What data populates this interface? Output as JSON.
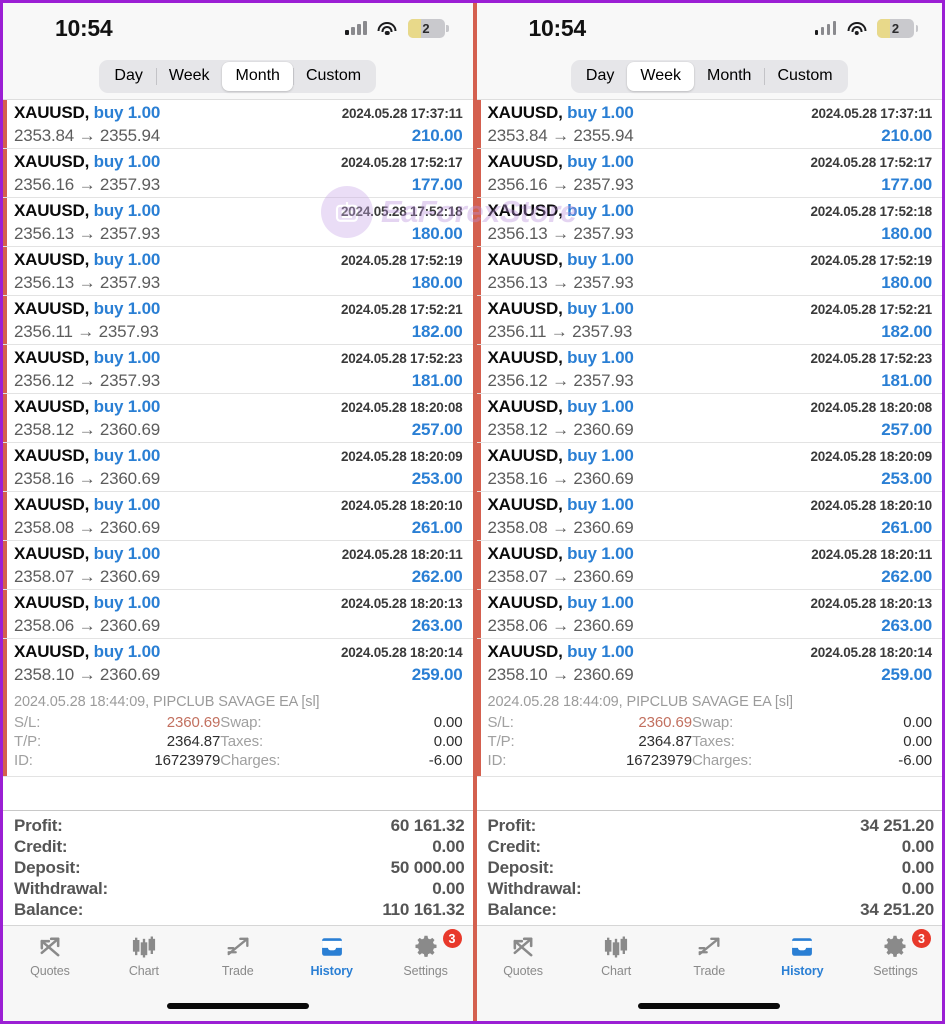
{
  "status_bar": {
    "time": "10:54",
    "battery_level": "2",
    "signal_icon": "cellular-signal-icon",
    "wifi_icon": "wifi-icon",
    "battery_icon": "battery-icon"
  },
  "period_filter": {
    "options": [
      "Day",
      "Week",
      "Month",
      "Custom"
    ],
    "left_selected": "Month",
    "right_selected": "Week"
  },
  "colors": {
    "profit_blue": "#2a7fd4",
    "accent_red": "#d4604f",
    "badge_red": "#e8392b",
    "frame_purple": "#9b1fd4"
  },
  "deals": [
    {
      "symbol": "XAUUSD,",
      "side": "buy",
      "volume": "1.00",
      "time": "2024.05.28 17:37:11",
      "open": "2353.84",
      "close": "2355.94",
      "profit": "210.00"
    },
    {
      "symbol": "XAUUSD,",
      "side": "buy",
      "volume": "1.00",
      "time": "2024.05.28 17:52:17",
      "open": "2356.16",
      "close": "2357.93",
      "profit": "177.00"
    },
    {
      "symbol": "XAUUSD,",
      "side": "buy",
      "volume": "1.00",
      "time": "2024.05.28 17:52:18",
      "open": "2356.13",
      "close": "2357.93",
      "profit": "180.00"
    },
    {
      "symbol": "XAUUSD,",
      "side": "buy",
      "volume": "1.00",
      "time": "2024.05.28 17:52:19",
      "open": "2356.13",
      "close": "2357.93",
      "profit": "180.00"
    },
    {
      "symbol": "XAUUSD,",
      "side": "buy",
      "volume": "1.00",
      "time": "2024.05.28 17:52:21",
      "open": "2356.11",
      "close": "2357.93",
      "profit": "182.00"
    },
    {
      "symbol": "XAUUSD,",
      "side": "buy",
      "volume": "1.00",
      "time": "2024.05.28 17:52:23",
      "open": "2356.12",
      "close": "2357.93",
      "profit": "181.00"
    },
    {
      "symbol": "XAUUSD,",
      "side": "buy",
      "volume": "1.00",
      "time": "2024.05.28 18:20:08",
      "open": "2358.12",
      "close": "2360.69",
      "profit": "257.00"
    },
    {
      "symbol": "XAUUSD,",
      "side": "buy",
      "volume": "1.00",
      "time": "2024.05.28 18:20:09",
      "open": "2358.16",
      "close": "2360.69",
      "profit": "253.00"
    },
    {
      "symbol": "XAUUSD,",
      "side": "buy",
      "volume": "1.00",
      "time": "2024.05.28 18:20:10",
      "open": "2358.08",
      "close": "2360.69",
      "profit": "261.00"
    },
    {
      "symbol": "XAUUSD,",
      "side": "buy",
      "volume": "1.00",
      "time": "2024.05.28 18:20:11",
      "open": "2358.07",
      "close": "2360.69",
      "profit": "262.00"
    },
    {
      "symbol": "XAUUSD,",
      "side": "buy",
      "volume": "1.00",
      "time": "2024.05.28 18:20:13",
      "open": "2358.06",
      "close": "2360.69",
      "profit": "263.00"
    },
    {
      "symbol": "XAUUSD,",
      "side": "buy",
      "volume": "1.00",
      "time": "2024.05.28 18:20:14",
      "open": "2358.10",
      "close": "2360.69",
      "profit": "259.00"
    }
  ],
  "expanded_detail": {
    "close_info": "2024.05.28 18:44:09, PIPCLUB SAVAGE EA [sl]",
    "sl_label": "S/L:",
    "sl_value": "2360.69",
    "tp_label": "T/P:",
    "tp_value": "2364.87",
    "id_label": "ID:",
    "id_value": "16723979",
    "swap_label": "Swap:",
    "swap_value": "0.00",
    "taxes_label": "Taxes:",
    "taxes_value": "0.00",
    "charges_label": "Charges:",
    "charges_value": "-6.00"
  },
  "totals_left": {
    "profit_label": "Profit:",
    "profit_value": "60 161.32",
    "credit_label": "Credit:",
    "credit_value": "0.00",
    "deposit_label": "Deposit:",
    "deposit_value": "50 000.00",
    "withdrawal_label": "Withdrawal:",
    "withdrawal_value": "0.00",
    "balance_label": "Balance:",
    "balance_value": "110 161.32"
  },
  "totals_right": {
    "profit_label": "Profit:",
    "profit_value": "34 251.20",
    "credit_label": "Credit:",
    "credit_value": "0.00",
    "deposit_label": "Deposit:",
    "deposit_value": "0.00",
    "withdrawal_label": "Withdrawal:",
    "withdrawal_value": "0.00",
    "balance_label": "Balance:",
    "balance_value": "34 251.20"
  },
  "tab_bar": {
    "tabs": [
      {
        "label": "Quotes",
        "icon": "quotes-arrows-icon",
        "active": false
      },
      {
        "label": "Chart",
        "icon": "candlestick-chart-icon",
        "active": false
      },
      {
        "label": "Trade",
        "icon": "trade-trend-icon",
        "active": false
      },
      {
        "label": "History",
        "icon": "history-inbox-icon",
        "active": true
      },
      {
        "label": "Settings",
        "icon": "settings-gear-icon",
        "active": false,
        "badge": "3"
      }
    ]
  },
  "watermark": {
    "text": "EaForexStore",
    "icon": "robot-icon"
  }
}
